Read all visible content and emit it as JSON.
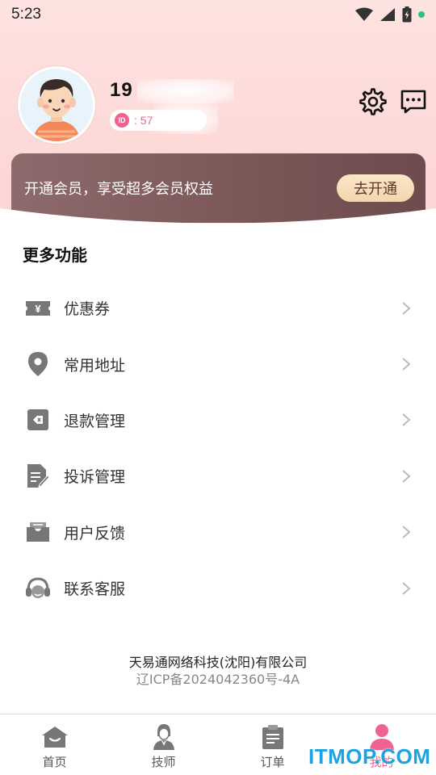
{
  "status_bar": {
    "time": "5:23"
  },
  "profile": {
    "username": "19",
    "id_badge": "ID",
    "id_value": ": 57"
  },
  "vip": {
    "text": "开通会员，享受超多会员权益",
    "button": "去开通"
  },
  "section": {
    "title": "更多功能"
  },
  "menu": [
    {
      "label": "优惠券",
      "icon": "coupon-icon"
    },
    {
      "label": "常用地址",
      "icon": "location-icon"
    },
    {
      "label": "退款管理",
      "icon": "refund-icon"
    },
    {
      "label": "投诉管理",
      "icon": "complaint-icon"
    },
    {
      "label": "用户反馈",
      "icon": "feedback-icon"
    },
    {
      "label": "联系客服",
      "icon": "headset-icon"
    }
  ],
  "company": {
    "name": "天易通网络科技(沈阳)有限公司",
    "icp": "辽ICP备2024042360号-4A"
  },
  "tabs": [
    {
      "label": "首页",
      "icon": "home-icon",
      "active": false
    },
    {
      "label": "技师",
      "icon": "technician-icon",
      "active": false
    },
    {
      "label": "订单",
      "icon": "order-icon",
      "active": false
    },
    {
      "label": "我的",
      "icon": "profile-icon",
      "active": true
    }
  ],
  "watermark": "ITMOP.COM",
  "colors": {
    "accent": "#f06292",
    "banner": "#7a5657",
    "button_gold": "#f5d6ad",
    "icon_gray": "#777777"
  }
}
